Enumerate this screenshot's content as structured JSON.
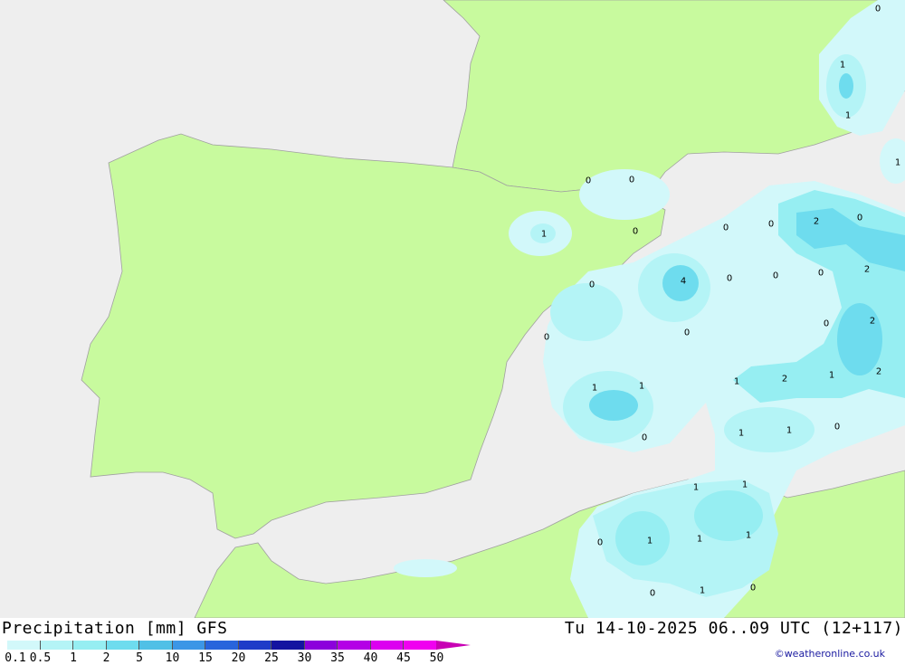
{
  "footer": {
    "title": "Precipitation [mm] GFS",
    "valid_time": "Tu 14-10-2025 06..09 UTC (12+117)",
    "credit": "©weatheronline.co.uk"
  },
  "legend": {
    "ticks": [
      "0.1",
      "0.5",
      "1",
      "2",
      "5",
      "10",
      "15",
      "20",
      "25",
      "30",
      "35",
      "40",
      "45",
      "50"
    ],
    "colors": [
      "#d2f8fa",
      "#b4f4f6",
      "#96eef2",
      "#6edcee",
      "#50c0e6",
      "#3c96e6",
      "#2864dc",
      "#1e3cc8",
      "#1414a0",
      "#8c00dc",
      "#b400e6",
      "#dc00f0",
      "#f000f0",
      "#c800b4"
    ]
  },
  "map": {
    "land_color": "#c8fa9e",
    "sea_color": "#eeeeee",
    "value_labels": [
      {
        "name": "label-0-ne",
        "text": "0"
      },
      {
        "name": "label-1-n1",
        "text": "1"
      },
      {
        "name": "label-1-n2",
        "text": "1"
      },
      {
        "name": "label-1-e",
        "text": "1"
      },
      {
        "name": "label-0-pyr1",
        "text": "0"
      },
      {
        "name": "label-0-pyr2",
        "text": "0"
      },
      {
        "name": "label-1-ebro",
        "text": "1"
      },
      {
        "name": "label-0-cat",
        "text": "0"
      },
      {
        "name": "label-0-m1",
        "text": "0"
      },
      {
        "name": "label-0-m2",
        "text": "0"
      },
      {
        "name": "label-2-m1",
        "text": "2"
      },
      {
        "name": "label-0-m3",
        "text": "0"
      },
      {
        "name": "label-4-bal",
        "text": "4"
      },
      {
        "name": "label-0-m4",
        "text": "0"
      },
      {
        "name": "label-0-m5",
        "text": "0"
      },
      {
        "name": "label-0-m6",
        "text": "0"
      },
      {
        "name": "label-2-m2",
        "text": "2"
      },
      {
        "name": "label-0-val",
        "text": "0"
      },
      {
        "name": "label-0-val2",
        "text": "0"
      },
      {
        "name": "label-0-maj",
        "text": "0"
      },
      {
        "name": "label-0-m7",
        "text": "0"
      },
      {
        "name": "label-2-m3",
        "text": "2"
      },
      {
        "name": "label-1-sw1",
        "text": "1"
      },
      {
        "name": "label-1-sw2",
        "text": "1"
      },
      {
        "name": "label-1-s1",
        "text": "1"
      },
      {
        "name": "label-2-s1",
        "text": "2"
      },
      {
        "name": "label-1-s2",
        "text": "1"
      },
      {
        "name": "label-2-s2",
        "text": "2"
      },
      {
        "name": "label-0-sw",
        "text": "0"
      },
      {
        "name": "label-1-s3",
        "text": "1"
      },
      {
        "name": "label-1-s4",
        "text": "1"
      },
      {
        "name": "label-0-s",
        "text": "0"
      },
      {
        "name": "label-1-af1",
        "text": "1"
      },
      {
        "name": "label-1-af2",
        "text": "1"
      },
      {
        "name": "label-0-af1",
        "text": "0"
      },
      {
        "name": "label-1-af3",
        "text": "1"
      },
      {
        "name": "label-1-af4",
        "text": "1"
      },
      {
        "name": "label-1-af5",
        "text": "1"
      },
      {
        "name": "label-0-af2",
        "text": "0"
      },
      {
        "name": "label-1-af6",
        "text": "1"
      },
      {
        "name": "label-0-af3",
        "text": "0"
      }
    ]
  }
}
